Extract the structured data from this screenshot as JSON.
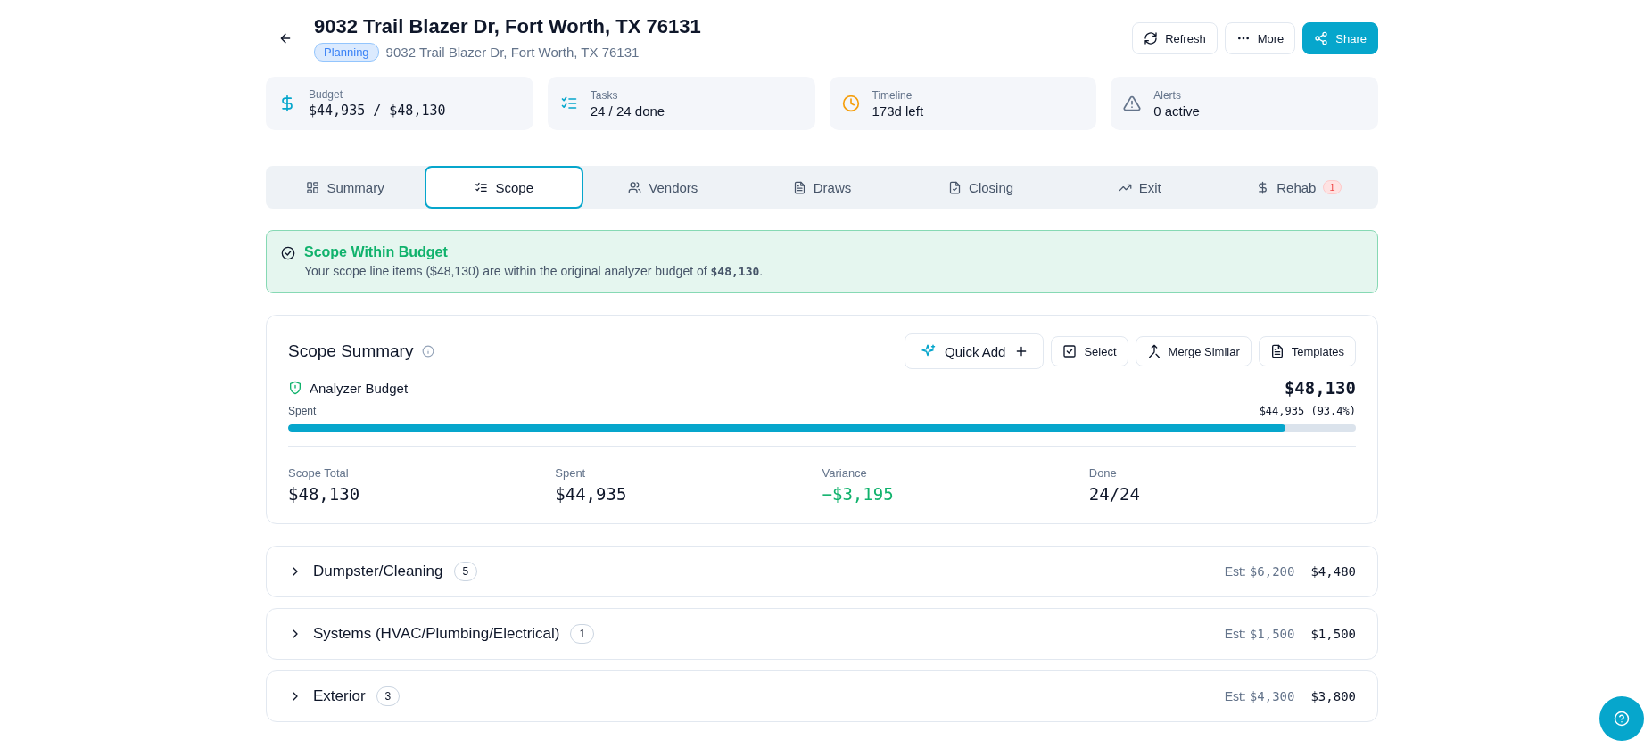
{
  "header": {
    "title": "9032 Trail Blazer Dr, Fort Worth, TX 76131",
    "status": "Planning",
    "address": "9032 Trail Blazer Dr, Fort Worth, TX 76131",
    "actions": [
      {
        "kind": "refresh",
        "label": "Refresh"
      },
      {
        "kind": "more",
        "label": "More"
      },
      {
        "kind": "share",
        "label": "Share"
      }
    ]
  },
  "stats": [
    {
      "kind": "budget",
      "label": "Budget",
      "value": "$44,935 / $48,130"
    },
    {
      "kind": "tasks",
      "label": "Tasks",
      "value": "24 / 24 done"
    },
    {
      "kind": "timeline",
      "label": "Timeline",
      "value": "173d left"
    },
    {
      "kind": "alerts",
      "label": "Alerts",
      "value": "0 active"
    }
  ],
  "tabs": [
    {
      "kind": "summary",
      "label": "Summary",
      "selected": false
    },
    {
      "kind": "scope",
      "label": "Scope",
      "selected": true
    },
    {
      "kind": "vendors",
      "label": "Vendors",
      "selected": false
    },
    {
      "kind": "draws",
      "label": "Draws",
      "selected": false
    },
    {
      "kind": "closing",
      "label": "Closing",
      "selected": false
    },
    {
      "kind": "exit",
      "label": "Exit",
      "selected": false
    },
    {
      "kind": "rehab",
      "label": "Rehab",
      "selected": false,
      "badge": "1"
    }
  ],
  "alert": {
    "title": "Scope Within Budget",
    "message": "Your scope line items ($48,130) are within the original analyzer budget of **$48,130**."
  },
  "scope_summary": {
    "title": "Scope Summary",
    "actions": [
      {
        "kind": "quick-add",
        "label": "Quick Add"
      },
      {
        "kind": "select",
        "label": "Select"
      },
      {
        "kind": "merge",
        "label": "Merge Similar"
      },
      {
        "kind": "templates",
        "label": "Templates"
      }
    ],
    "budget_label": "Analyzer Budget",
    "budget_value": "$48,130",
    "spent_label": "Spent",
    "spent_reading": "$44,935 (93.4%)",
    "level": 0.934,
    "metrics": [
      {
        "label": "Scope Total",
        "value": "$48,130",
        "positive": false
      },
      {
        "label": "Spent",
        "value": "$44,935",
        "positive": false
      },
      {
        "label": "Variance",
        "value": "−$3,195",
        "positive": true
      },
      {
        "label": "Done",
        "value": "24/24",
        "positive": false
      }
    ]
  },
  "categories": [
    {
      "name": "Dumpster/Cleaning",
      "count": "5",
      "est_label": "Est:",
      "estimate": "$6,200",
      "amount": "$4,480",
      "expanded": false
    },
    {
      "name": "Systems (HVAC/Plumbing/Electrical)",
      "count": "1",
      "est_label": "Est:",
      "estimate": "$1,500",
      "amount": "$1,500",
      "expanded": false
    },
    {
      "name": "Exterior",
      "count": "3",
      "est_label": "Est:",
      "estimate": "$4,300",
      "amount": "$3,800",
      "expanded": false
    }
  ]
}
